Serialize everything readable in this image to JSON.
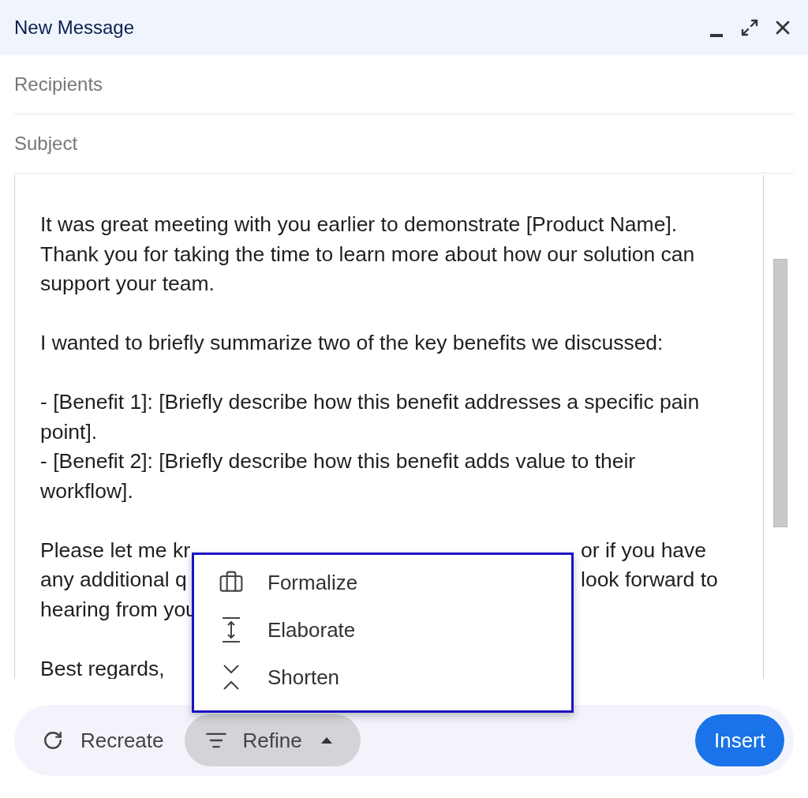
{
  "window": {
    "title": "New Message"
  },
  "recipients": {
    "placeholder": "Recipients"
  },
  "subject": {
    "placeholder": "Subject"
  },
  "body": {
    "paragraphs": [
      {
        "lines": [
          {
            "text": "It was great meeting with you earlier to demonstrate [Product Name]."
          },
          {
            "text": "Thank you for taking the time to learn more about how our solution can"
          },
          {
            "text": "support your team."
          }
        ]
      },
      {
        "lines": [
          {
            "text": "I wanted to briefly summarize two of the key benefits we discussed:"
          }
        ]
      },
      {
        "lines": [
          {
            "text": "- [Benefit 1]: [Briefly describe how this benefit addresses a specific pain"
          },
          {
            "text": "point]."
          },
          {
            "text": "- [Benefit 2]: [Briefly describe how this benefit adds value to their"
          },
          {
            "text": "workflow]."
          }
        ]
      },
      {
        "lines": [
          {
            "text": "Please let me kr",
            "after_menu": "or if you have"
          },
          {
            "text": "any additional q",
            "after_menu": "look forward to"
          },
          {
            "text": "hearing from you"
          }
        ]
      },
      {
        "lines": [
          {
            "text": "Best regards,"
          }
        ]
      }
    ]
  },
  "refine_menu": {
    "items": [
      {
        "kind": "formalize",
        "label": "Formalize"
      },
      {
        "kind": "elaborate",
        "label": "Elaborate"
      },
      {
        "kind": "shorten",
        "label": "Shorten"
      }
    ]
  },
  "toolbar": {
    "recreate": "Recreate",
    "refine": {
      "label": "Refine",
      "expanded": true
    },
    "insert": "Insert"
  }
}
